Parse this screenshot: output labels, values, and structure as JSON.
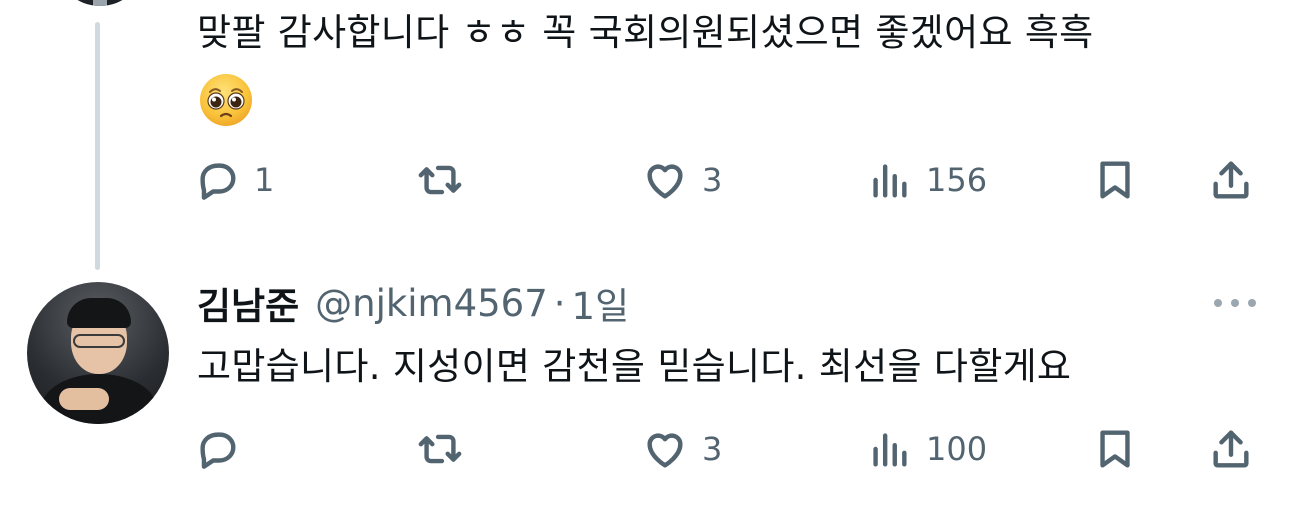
{
  "reply_thread": {
    "text_line1": "맞팔 감사합니다 ㅎㅎ 꼭 국회의원되셨으면 좋겠어요 흑흑",
    "emoji": "pleading-face",
    "actions": {
      "reply_count": "1",
      "retweet_count": "",
      "like_count": "3",
      "views_count": "156"
    }
  },
  "tweet": {
    "display_name": "김남준",
    "handle": "@njkim4567",
    "separator": "·",
    "time": "1일",
    "text_line1": "고맙습니다. 지성이면 감천을 믿습니다. 최선을 다할게요",
    "actions": {
      "reply_count": "",
      "retweet_count": "",
      "like_count": "3",
      "views_count": "100"
    }
  },
  "colors": {
    "text": "#0f1419",
    "secondary": "#536471",
    "thread_line": "#cfd9de"
  },
  "icons": [
    "reply-icon",
    "retweet-icon",
    "like-icon",
    "views-icon",
    "bookmark-icon",
    "share-icon",
    "more-icon"
  ]
}
